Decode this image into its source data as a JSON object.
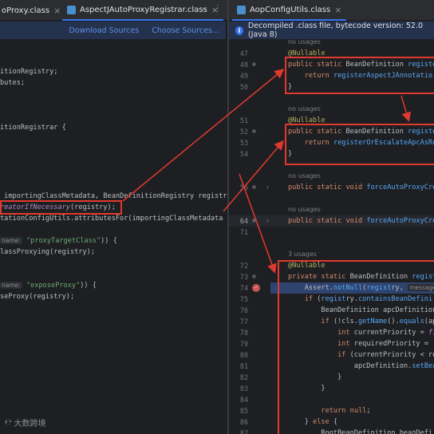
{
  "tabs": {
    "left_partial": "oProxy.class",
    "middle": "AspectJAutoProxyRegistrar.class",
    "right": "AopConfigUtils.class"
  },
  "left_infobar": {
    "download_sources": "Download Sources",
    "choose_sources": "Choose Sources..."
  },
  "right_infobar": {
    "message": "Decompiled .class file, bytecode version: 52.0 (Java 8)"
  },
  "left_code": [
    "",
    "",
    "itionRegistry;",
    "butes;",
    "",
    "",
    "",
    "itionRegistrar {",
    "",
    "",
    "",
    "",
    " importingClassMetadata, BeanDefinitionRegistry registry",
    "",
    "tationConfigUtils.attributesFor(importingClassMetadata",
    "",
    "",
    "lassProxying(registry);",
    "",
    "",
    "",
    "seProxy(registry);"
  ],
  "left_special": {
    "called_method": "reatorIfNecessary",
    "called_args": "(registry);",
    "param_hint_1": "name:",
    "string_1": "\"proxyTargetClass\"",
    "tail_1": ")) {",
    "param_hint_2": "name:",
    "string_2": "\"exposeProxy\"",
    "tail_2": ")) {"
  },
  "right_lines": [
    {
      "n": "",
      "type": "hint",
      "text": "no usages"
    },
    {
      "n": "47",
      "type": "ann",
      "text": "@Nullable"
    },
    {
      "n": "48",
      "type": "code",
      "text": "public static BeanDefinition registe"
    },
    {
      "n": "49",
      "type": "code",
      "text": "    return registerAspectJAnnotatio"
    },
    {
      "n": "50",
      "type": "code",
      "text": "}"
    },
    {
      "n": "",
      "type": "blank",
      "text": ""
    },
    {
      "n": "",
      "type": "hint",
      "text": "no usages"
    },
    {
      "n": "51",
      "type": "ann",
      "text": "@Nullable"
    },
    {
      "n": "52",
      "type": "code",
      "text": "public static BeanDefinition registe"
    },
    {
      "n": "53",
      "type": "code",
      "text": "    return registerOrEscalateApcAsRe"
    },
    {
      "n": "54",
      "type": "code",
      "text": "}"
    },
    {
      "n": "",
      "type": "blank",
      "text": ""
    },
    {
      "n": "",
      "type": "hint",
      "text": "no usages"
    },
    {
      "n": "56",
      "type": "code",
      "text": "public static void forceAutoProxyCre"
    },
    {
      "n": "",
      "type": "blank",
      "text": ""
    },
    {
      "n": "",
      "type": "hint",
      "text": "no usages"
    },
    {
      "n": "64",
      "type": "code",
      "text": "public static void forceAutoProxyCre"
    },
    {
      "n": "71",
      "type": "blank",
      "text": ""
    },
    {
      "n": "",
      "type": "blank",
      "text": ""
    },
    {
      "n": "",
      "type": "hint",
      "text": "3 usages"
    },
    {
      "n": "72",
      "type": "ann",
      "text": "@Nullable"
    },
    {
      "n": "73",
      "type": "code",
      "text": "private static BeanDefinition regist"
    },
    {
      "n": "74",
      "type": "code",
      "text": "    Assert.notNull(registry, "
    },
    {
      "n": "75",
      "type": "code",
      "text": "    if (registry.containsBeanDefini"
    },
    {
      "n": "76",
      "type": "code",
      "text": "        BeanDefinition apcDefinition"
    },
    {
      "n": "77",
      "type": "code",
      "text": "        if (!cls.getName().equals(ap"
    },
    {
      "n": "78",
      "type": "code",
      "text": "            int currentPriority = fi"
    },
    {
      "n": "79",
      "type": "code",
      "text": "            int requiredPriority = "
    },
    {
      "n": "80",
      "type": "code",
      "text": "            if (currentPriority < re"
    },
    {
      "n": "81",
      "type": "code",
      "text": "                apcDefinition.setBea"
    },
    {
      "n": "82",
      "type": "code",
      "text": "            }"
    },
    {
      "n": "83",
      "type": "code",
      "text": "        }"
    },
    {
      "n": "84",
      "type": "blank",
      "text": ""
    },
    {
      "n": "85",
      "type": "code",
      "text": "        return null;"
    },
    {
      "n": "86",
      "type": "code",
      "text": "    } else {"
    },
    {
      "n": "87",
      "type": "code",
      "text": "        RootBeanDefinition beanDefi"
    }
  ],
  "right_param_hint": "message:",
  "watermark": "大数跨境",
  "colors": {
    "background": "#1e1f22",
    "annotation_red": "#e03a2e",
    "keyword": "#cf8e6d",
    "method": "#56a8f5",
    "string": "#6aab73",
    "selection": "#2e436e"
  }
}
